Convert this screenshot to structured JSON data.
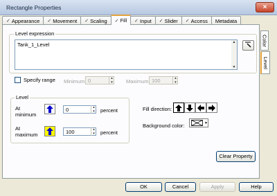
{
  "window": {
    "title": "Rectangle Properties"
  },
  "tabs": [
    {
      "label": "Appearance",
      "checked": true
    },
    {
      "label": "Movement",
      "checked": true
    },
    {
      "label": "Scaling",
      "checked": true
    },
    {
      "label": "Fill",
      "checked": true,
      "active": true
    },
    {
      "label": "Input",
      "checked": true
    },
    {
      "label": "Slider",
      "checked": true
    },
    {
      "label": "Access",
      "checked": true
    },
    {
      "label": "Metadata",
      "checked": false
    }
  ],
  "side_tabs": {
    "color": "Color",
    "level": "Level"
  },
  "level_expression": {
    "title": "Level expression",
    "value": "Tank_1_Level"
  },
  "specify_range": {
    "label": "Specify range",
    "minimum_label": "Minimum:",
    "minimum_value": "0",
    "maximum_label": "Maximum:",
    "maximum_value": "100"
  },
  "level": {
    "title": "Level",
    "at_minimum_label_1": "At",
    "at_minimum_label_2": "minimum",
    "at_minimum_value": "0",
    "at_maximum_label_1": "At",
    "at_maximum_label_2": "maximum",
    "at_maximum_value": "100",
    "percent_label": "percent"
  },
  "fill": {
    "direction_label": "Fill direction:",
    "background_label": "Background color:"
  },
  "buttons": {
    "clear": "Clear Property",
    "ok": "OK",
    "cancel": "Cancel",
    "apply": "Apply",
    "help": "Help"
  },
  "colors": {
    "arrow_blue": "#0000cc",
    "arrow_bg_yellow": "#ffff00",
    "tab_highlight": "#e6a23c"
  }
}
